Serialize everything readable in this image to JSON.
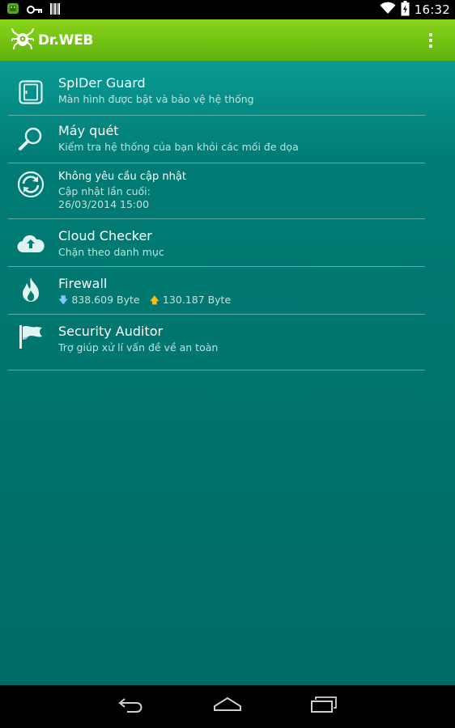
{
  "status_bar": {
    "time": "16:32",
    "icons": [
      "android-notification-icon",
      "key-icon",
      "barcode-icon",
      "wifi-icon",
      "battery-icon"
    ]
  },
  "app": {
    "name": "Dr.WEB",
    "brand_color": "#74c212"
  },
  "menu": {
    "items": [
      {
        "id": "spider-guard",
        "icon": "shield-door-icon",
        "title": "SpIDer Guard",
        "subtitle": "Màn hình được bật và bảo vệ hệ thống"
      },
      {
        "id": "scanner",
        "icon": "magnifier-icon",
        "title": "Máy quét",
        "subtitle": "Kiểm tra hệ thống của bạn khỏi các mối đe dọa"
      },
      {
        "id": "update",
        "icon": "update-sync-icon",
        "title": "Không yêu cầu cập nhật",
        "subtitle_line1": "Cập nhật lần cuối:",
        "subtitle_line2": "26/03/2014 15:00"
      },
      {
        "id": "cloud-checker",
        "icon": "cloud-icon",
        "title": "Cloud Checker",
        "subtitle": "Chặn theo danh mục"
      },
      {
        "id": "firewall",
        "icon": "flame-icon",
        "title": "Firewall",
        "download": "838.609 Byte",
        "upload": "130.187 Byte"
      },
      {
        "id": "security-auditor",
        "icon": "flag-icon",
        "title": "Security Auditor",
        "subtitle": "Trợ giúp xử lí vấn đề về an toàn"
      }
    ]
  },
  "nav_bar": {
    "buttons": [
      "back-icon",
      "home-icon",
      "recent-apps-icon"
    ]
  }
}
